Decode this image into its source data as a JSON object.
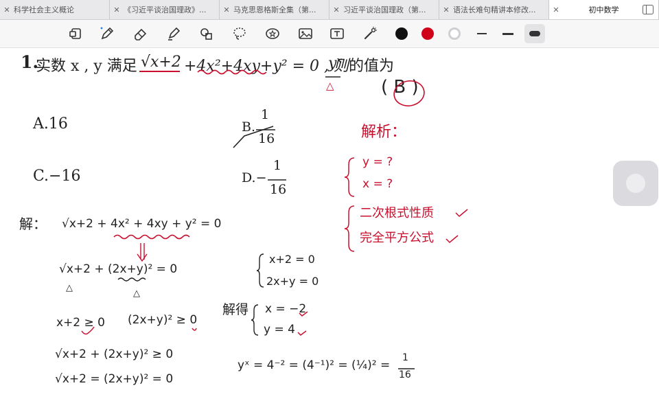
{
  "tabs": [
    {
      "label": "科学社会主义概论",
      "active": false
    },
    {
      "label": "《习近平谈治国理政》...",
      "active": false
    },
    {
      "label": "马克思恩格斯全集（第...",
      "active": false
    },
    {
      "label": "习近平谈治国理政（第...",
      "active": false
    },
    {
      "label": "语法长难句精讲本修改...",
      "active": false
    },
    {
      "label": "初中数学",
      "active": true
    }
  ],
  "toolbar": {
    "tools": [
      "page-view-icon",
      "pen-icon",
      "eraser-icon",
      "highlighter-icon",
      "shapes-icon",
      "lasso-icon",
      "sticker-icon",
      "image-icon",
      "text-box-icon",
      "laser-pointer-icon"
    ],
    "colors": [
      "#111111",
      "#d0001a",
      "#ffffff"
    ],
    "accent": "#c8102e"
  },
  "question": {
    "number": "1.",
    "stem_prefix": "实数 x , y 满足",
    "expr_root": "√x+2",
    "expr_rest": "+4x²+4xy+y² = 0 , 则",
    "expr_power": "yˣ",
    "stem_suffix": "的值为",
    "triangle": "△",
    "answer_paren": "( B )",
    "options": {
      "A": "A.16",
      "B_prefix": "B.",
      "B_num": "1",
      "B_den": "16",
      "C": "C.−16",
      "D_prefix": "D.−",
      "D_num": "1",
      "D_den": "16"
    }
  },
  "notes": {
    "analysis_title": "解析：",
    "y_q": "y = ?",
    "x_q": "x = ?",
    "prop1": "二次根式性质",
    "prop2": "完全平方公式"
  },
  "work": {
    "label": "解：",
    "eq1": "√x+2  +  4x² + 4xy + y² = 0",
    "eq2": "√x+2  +  (2x+y)²  =  0",
    "tri1": "△",
    "tri2": "△",
    "ineq1": "x+2 ≥ 0",
    "ineq2": "(2x+y)² ≥ 0",
    "eq3": "√x+2  +  (2x+y)²  ≥ 0",
    "eq4": "√x+2  =  (2x+y)²  = 0",
    "sys1": "x+2 = 0",
    "sys2": "2x+y = 0",
    "solved_label": "解得",
    "x_val": "x = −2",
    "y_val": "y = 4",
    "final": "yˣ  =  4⁻²  =  (4⁻¹)²  =  (¼)²  =",
    "final_num": "1",
    "final_den": "16"
  }
}
